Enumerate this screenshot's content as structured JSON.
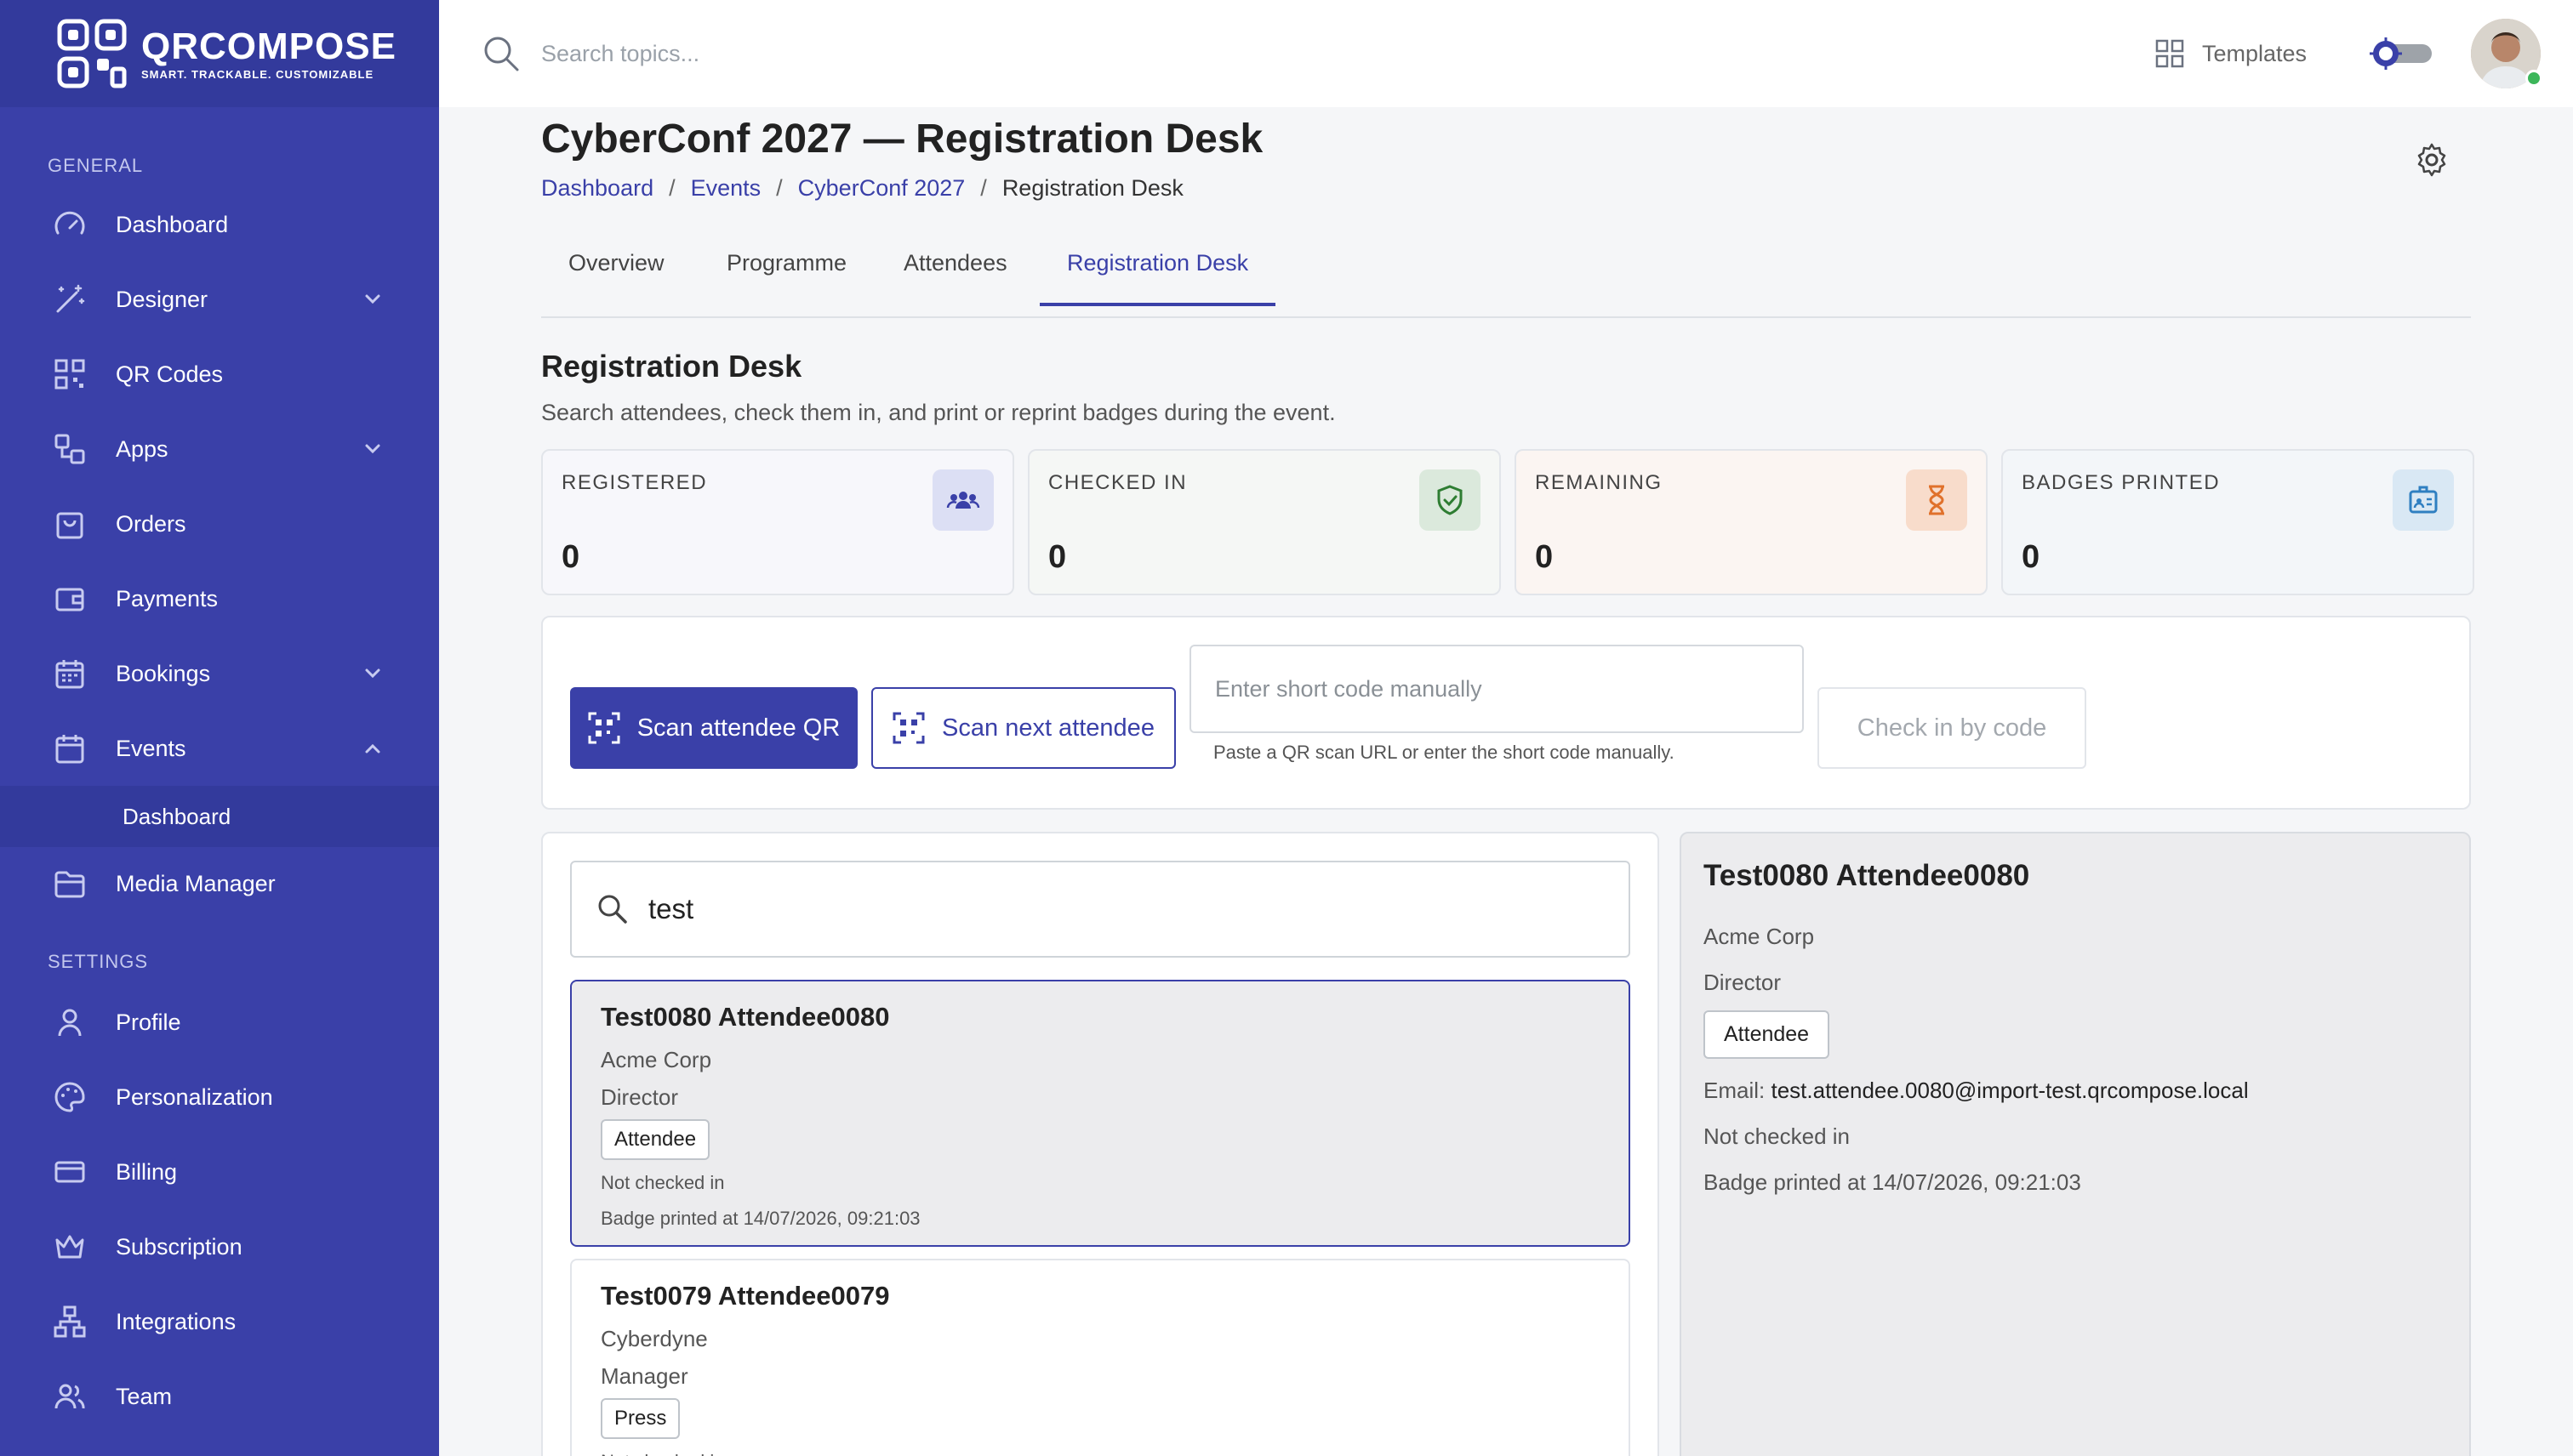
{
  "brand": {
    "name": "QRCOMPOSE",
    "tagline": "SMART. TRACKABLE. CUSTOMIZABLE"
  },
  "sidebar": {
    "general_label": "GENERAL",
    "settings_label": "SETTINGS",
    "items": [
      {
        "label": "Dashboard",
        "icon": "gauge-icon"
      },
      {
        "label": "Designer",
        "icon": "magic-wand-icon",
        "expandable": true
      },
      {
        "label": "QR Codes",
        "icon": "qr-code-icon"
      },
      {
        "label": "Apps",
        "icon": "apps-icon",
        "expandable": true
      },
      {
        "label": "Orders",
        "icon": "shopping-bag-icon"
      },
      {
        "label": "Payments",
        "icon": "wallet-icon"
      },
      {
        "label": "Bookings",
        "icon": "calendar-icon",
        "expandable": true
      },
      {
        "label": "Events",
        "icon": "calendar-icon",
        "expanded": true
      },
      {
        "label": "Media Manager",
        "icon": "folder-icon"
      }
    ],
    "events_sub": {
      "label": "Dashboard"
    },
    "settings_items": [
      {
        "label": "Profile",
        "icon": "user-icon"
      },
      {
        "label": "Personalization",
        "icon": "palette-icon"
      },
      {
        "label": "Billing",
        "icon": "credit-card-icon"
      },
      {
        "label": "Subscription",
        "icon": "crown-icon"
      },
      {
        "label": "Integrations",
        "icon": "network-icon"
      },
      {
        "label": "Team",
        "icon": "users-icon"
      }
    ]
  },
  "topbar": {
    "search_placeholder": "Search topics...",
    "templates_label": "Templates"
  },
  "page": {
    "title": "CyberConf 2027 — Registration Desk",
    "breadcrumb": [
      "Dashboard",
      "Events",
      "CyberConf 2027",
      "Registration Desk"
    ],
    "tabs": [
      "Overview",
      "Programme",
      "Attendees",
      "Registration Desk"
    ],
    "active_tab": "Registration Desk"
  },
  "registration": {
    "title": "Registration Desk",
    "description": "Search attendees, check them in, and print or reprint badges during the event.",
    "stats": [
      {
        "label": "REGISTERED",
        "value": "0",
        "icon": "users-icon",
        "color": "#3a40a8"
      },
      {
        "label": "CHECKED IN",
        "value": "0",
        "icon": "shield-check-icon",
        "color": "#2e7d32"
      },
      {
        "label": "REMAINING",
        "value": "0",
        "icon": "hourglass-icon",
        "color": "#e0712b"
      },
      {
        "label": "BADGES PRINTED",
        "value": "0",
        "icon": "id-badge-icon",
        "color": "#2f7fc1"
      }
    ],
    "scan_button": "Scan attendee QR",
    "scan_next_button": "Scan next attendee",
    "code_placeholder": "Enter short code manually",
    "code_hint": "Paste a QR scan URL or enter the short code manually.",
    "check_in_button": "Check in by code"
  },
  "attendee_search": {
    "value": "test"
  },
  "attendees": [
    {
      "name": "Test0080 Attendee0080",
      "company": "Acme Corp",
      "role": "Director",
      "type": "Attendee",
      "status": "Not checked in",
      "badge": "Badge printed at 14/07/2026, 09:21:03"
    },
    {
      "name": "Test0079 Attendee0079",
      "company": "Cyberdyne",
      "role": "Manager",
      "type": "Press",
      "status": "Not checked in",
      "badge": ""
    }
  ],
  "detail": {
    "name": "Test0080 Attendee0080",
    "company": "Acme Corp",
    "role": "Director",
    "type": "Attendee",
    "email_label": "Email:",
    "email": "test.attendee.0080@import-test.qrcompose.local",
    "status": "Not checked in",
    "badge": "Badge printed at 14/07/2026, 09:21:03"
  },
  "colors": {
    "accent": "#3a40a8",
    "sidebar": "#3a40a8",
    "online": "#3cb65a"
  }
}
